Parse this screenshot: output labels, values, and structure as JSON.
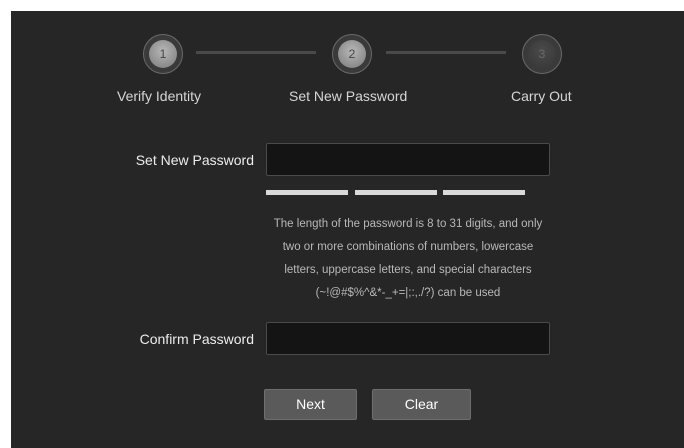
{
  "stepper": {
    "steps": [
      {
        "number": "1",
        "label": "Verify Identity"
      },
      {
        "number": "2",
        "label": "Set New Password"
      },
      {
        "number": "3",
        "label": "Carry Out"
      }
    ]
  },
  "form": {
    "new_password_label": "Set New Password",
    "new_password_value": "",
    "strength_segments": 3,
    "hint": "The length of the password is 8 to 31 digits, and only two or more combinations of numbers, lowercase letters, uppercase letters, and special characters (~!@#$%^&*-_+=|;:,./?) can be used",
    "confirm_password_label": "Confirm Password",
    "confirm_password_value": ""
  },
  "buttons": {
    "next_label": "Next",
    "clear_label": "Clear"
  },
  "colors": {
    "panel_background": "#262626",
    "input_background": "#141414",
    "button_background": "#5a5a5a"
  }
}
